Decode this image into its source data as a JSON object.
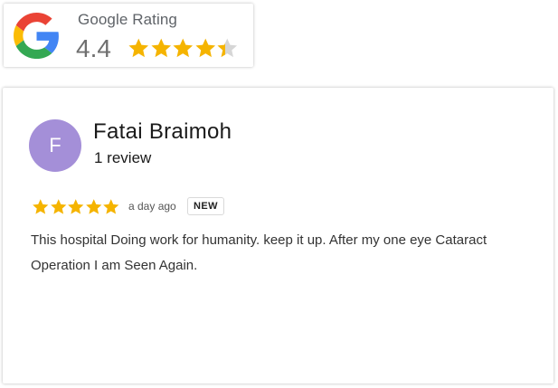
{
  "rating_badge": {
    "logo_icon": "google-g-icon",
    "title": "Google Rating",
    "score": "4.4",
    "stars": 4.4,
    "star_count": 5,
    "colors": {
      "star_filled": "#f5b400",
      "star_empty": "#d6d6d6",
      "title": "#5f6368",
      "score": "#6f6f6f"
    }
  },
  "review": {
    "avatar_letter": "F",
    "avatar_color": "#a48fd8",
    "reviewer_name": "Fatai Braimoh",
    "review_count": "1 review",
    "stars": 5,
    "time": "a day ago",
    "badge": "NEW",
    "text": "This hospital Doing work for humanity. keep it up. After my one eye Cataract Operation I am Seen Again."
  }
}
